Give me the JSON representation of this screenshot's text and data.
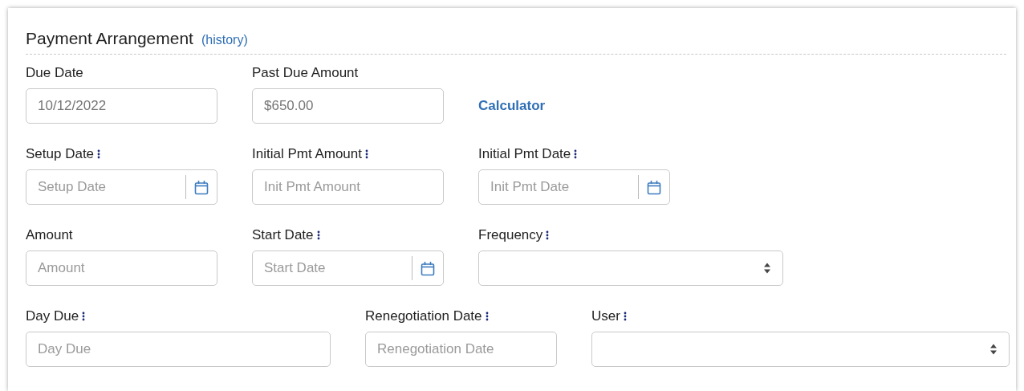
{
  "section": {
    "title": "Payment Arrangement",
    "history_link": "(history)"
  },
  "rows": [
    {
      "items": [
        {
          "kind": "readonly",
          "label": "Due Date",
          "marked": false,
          "value": "10/12/2022"
        },
        {
          "kind": "readonly",
          "label": "Past Due Amount",
          "marked": false,
          "value": "$650.00"
        },
        {
          "kind": "link",
          "text": "Calculator"
        }
      ]
    },
    {
      "items": [
        {
          "kind": "date",
          "label": "Setup Date",
          "marked": true,
          "placeholder": "Setup Date"
        },
        {
          "kind": "text",
          "label": "Initial Pmt Amount",
          "marked": true,
          "placeholder": "Init Pmt Amount"
        },
        {
          "kind": "date",
          "label": "Initial Pmt Date",
          "marked": true,
          "placeholder": "Init Pmt Date"
        }
      ]
    },
    {
      "items": [
        {
          "kind": "text",
          "label": "Amount",
          "marked": false,
          "placeholder": "Amount"
        },
        {
          "kind": "date",
          "label": "Start Date",
          "marked": true,
          "placeholder": "Start Date"
        },
        {
          "kind": "select",
          "label": "Frequency",
          "marked": true
        }
      ]
    },
    {
      "items": [
        {
          "kind": "text",
          "label": "Day Due",
          "marked": true,
          "placeholder": "Day Due"
        },
        {
          "kind": "text",
          "label": "Renegotiation Date",
          "marked": true,
          "placeholder": "Renegotiation Date"
        },
        {
          "kind": "select",
          "label": "User",
          "marked": true
        }
      ]
    }
  ]
}
